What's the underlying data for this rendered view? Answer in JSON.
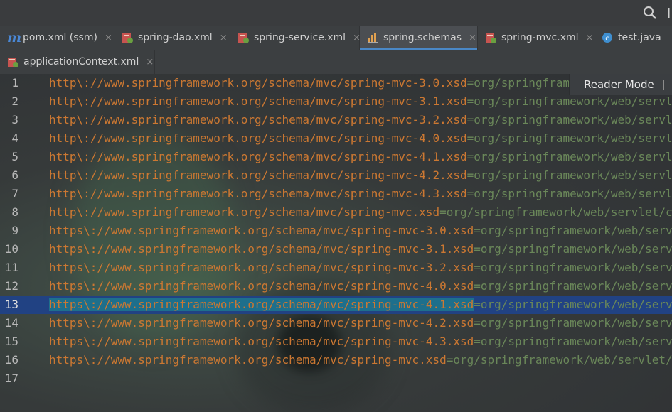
{
  "header": {
    "search_icon": "search-icon"
  },
  "tabs_row1": [
    {
      "label": "pom.xml (ssm)",
      "icon": "maven-icon"
    },
    {
      "label": "spring-dao.xml",
      "icon": "spring-xml-icon"
    },
    {
      "label": "spring-service.xml",
      "icon": "spring-xml-icon"
    },
    {
      "label": "spring.schemas",
      "icon": "properties-icon",
      "active": true
    },
    {
      "label": "spring-mvc.xml",
      "icon": "spring-xml-icon"
    },
    {
      "label": "test.java",
      "icon": "java-class-icon"
    }
  ],
  "tabs_row2": [
    {
      "label": "applicationContext.xml",
      "icon": "spring-xml-icon"
    }
  ],
  "tab_close_glyph": "×",
  "editor": {
    "reader_mode_label": "Reader Mode",
    "current_line": 13,
    "lines": [
      {
        "n": "1",
        "key": "http\\://www.springframework.org/schema/mvc/spring-mvc-3.0.xsd",
        "value": "=org/springframework/web/servlet/config/spring-mvc.xsd"
      },
      {
        "n": "2",
        "key": "http\\://www.springframework.org/schema/mvc/spring-mvc-3.1.xsd",
        "value": "=org/springframework/web/servlet/config/spring-mvc.xsd"
      },
      {
        "n": "3",
        "key": "http\\://www.springframework.org/schema/mvc/spring-mvc-3.2.xsd",
        "value": "=org/springframework/web/servlet/config/spring-mvc.xsd"
      },
      {
        "n": "4",
        "key": "http\\://www.springframework.org/schema/mvc/spring-mvc-4.0.xsd",
        "value": "=org/springframework/web/servlet/config/spring-mvc.xsd"
      },
      {
        "n": "5",
        "key": "http\\://www.springframework.org/schema/mvc/spring-mvc-4.1.xsd",
        "value": "=org/springframework/web/servlet/config/spring-mvc.xsd"
      },
      {
        "n": "6",
        "key": "http\\://www.springframework.org/schema/mvc/spring-mvc-4.2.xsd",
        "value": "=org/springframework/web/servlet/config/spring-mvc.xsd"
      },
      {
        "n": "7",
        "key": "http\\://www.springframework.org/schema/mvc/spring-mvc-4.3.xsd",
        "value": "=org/springframework/web/servlet/config/spring-mvc.xsd"
      },
      {
        "n": "8",
        "key": "http\\://www.springframework.org/schema/mvc/spring-mvc.xsd",
        "value": "=org/springframework/web/servlet/config/spring-mvc.xsd"
      },
      {
        "n": "9",
        "key": "https\\://www.springframework.org/schema/mvc/spring-mvc-3.0.xsd",
        "value": "=org/springframework/web/servlet/config/spring-mvc.xsd"
      },
      {
        "n": "10",
        "key": "https\\://www.springframework.org/schema/mvc/spring-mvc-3.1.xsd",
        "value": "=org/springframework/web/servlet/config/spring-mvc.xsd"
      },
      {
        "n": "11",
        "key": "https\\://www.springframework.org/schema/mvc/spring-mvc-3.2.xsd",
        "value": "=org/springframework/web/servlet/config/spring-mvc.xsd"
      },
      {
        "n": "12",
        "key": "https\\://www.springframework.org/schema/mvc/spring-mvc-4.0.xsd",
        "value": "=org/springframework/web/servlet/config/spring-mvc.xsd"
      },
      {
        "n": "13",
        "key": "https\\://www.springframework.org/schema/mvc/spring-mvc-4.1.xsd",
        "value": "=org/springframework/web/servlet/config/spring-mvc.xsd",
        "selected": true
      },
      {
        "n": "14",
        "key": "https\\://www.springframework.org/schema/mvc/spring-mvc-4.2.xsd",
        "value": "=org/springframework/web/servlet/config/spring-mvc.xsd"
      },
      {
        "n": "15",
        "key": "https\\://www.springframework.org/schema/mvc/spring-mvc-4.3.xsd",
        "value": "=org/springframework/web/servlet/config/spring-mvc.xsd"
      },
      {
        "n": "16",
        "key": "https\\://www.springframework.org/schema/mvc/spring-mvc.xsd",
        "value": "=org/springframework/web/servlet/config/spring-mvc.xsd"
      },
      {
        "n": "17",
        "key": "",
        "value": ""
      }
    ]
  },
  "colors": {
    "key": "#cc7832",
    "value": "#6a8759",
    "current_line": "#214283",
    "selection": "#1e6f8c",
    "active_tab_underline": "#4a88c7"
  }
}
